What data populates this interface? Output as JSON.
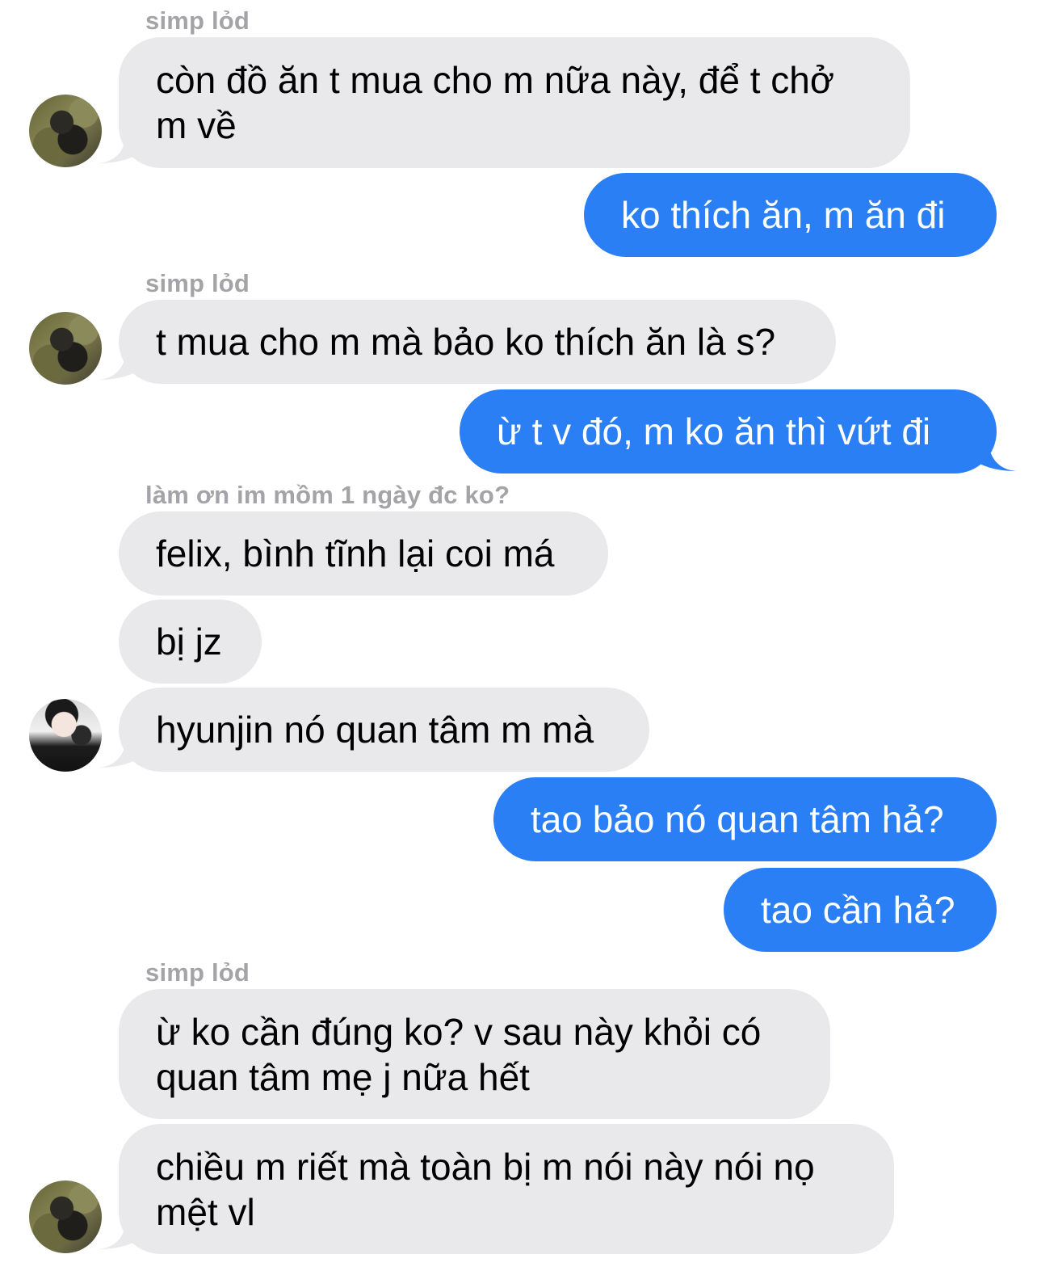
{
  "messages": [
    {
      "type": "name",
      "text": "simp lỏd"
    },
    {
      "type": "in",
      "text": "còn đồ ăn t mua cho m nữa này, để t chở m về",
      "avatar": "simp-lod-avatar"
    },
    {
      "type": "out",
      "text": "ko thích ăn, m ăn đi"
    },
    {
      "type": "name",
      "text": "simp lỏd"
    },
    {
      "type": "in",
      "text": "t mua cho m mà bảo ko thích ăn là s?",
      "avatar": "simp-lod-avatar"
    },
    {
      "type": "out",
      "text": "ừ t v đó, m ko ăn thì vứt đi"
    },
    {
      "type": "name",
      "text": "làm ơn im mồm 1 ngày đc ko?"
    },
    {
      "type": "in",
      "text": "felix, bình tĩnh lại coi má"
    },
    {
      "type": "in",
      "text": "bị jz"
    },
    {
      "type": "in",
      "text": "hyunjin nó quan tâm m mà",
      "avatar": "felix-avatar"
    },
    {
      "type": "out",
      "text": "tao bảo nó quan tâm hả?"
    },
    {
      "type": "out",
      "text": "tao cần hả?"
    },
    {
      "type": "name",
      "text": "simp lỏd"
    },
    {
      "type": "in",
      "text": "ừ ko cần đúng ko? v sau này khỏi có quan tâm mẹ j nữa hết"
    },
    {
      "type": "in",
      "text": "chiều m riết mà toàn bị m nói này nói nọ mệt vl",
      "avatar": "simp-lod-avatar"
    }
  ],
  "colors": {
    "incoming_bubble": "#e9e9eb",
    "outgoing_bubble": "#2a7ff5",
    "sender_name": "#a4a4a8"
  }
}
